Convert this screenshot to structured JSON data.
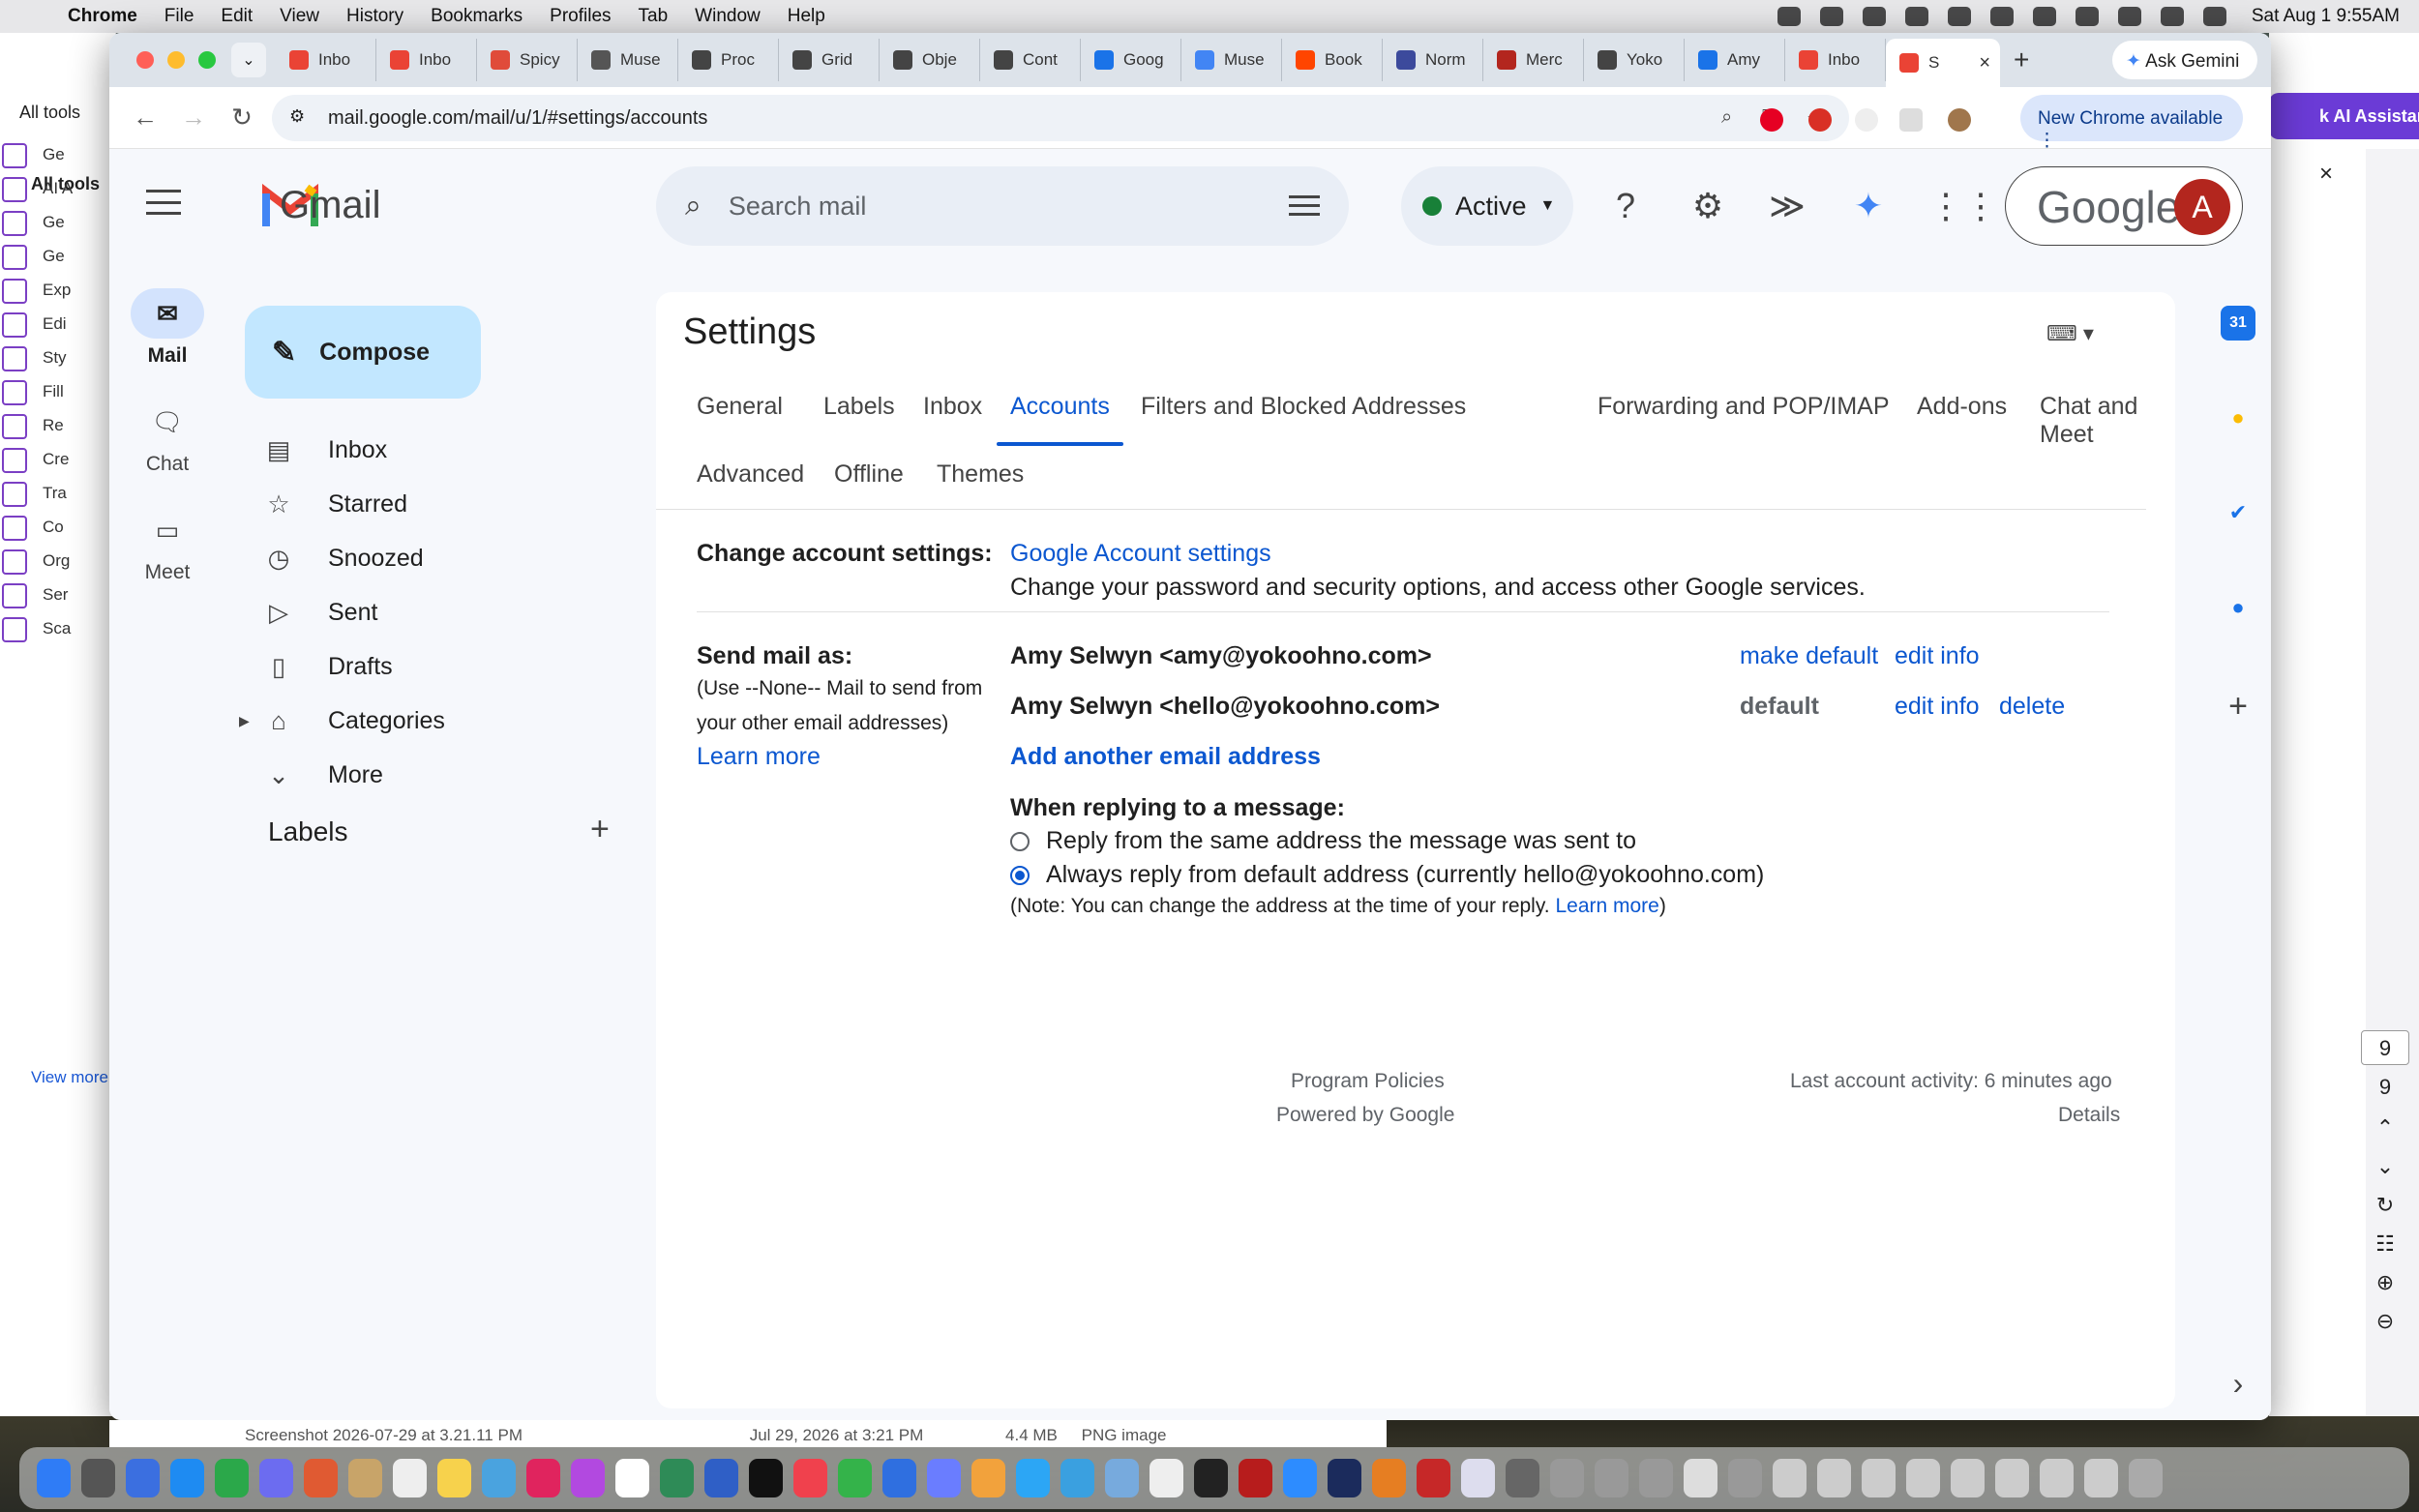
{
  "menubar": {
    "app": "Chrome",
    "items": [
      "File",
      "Edit",
      "View",
      "History",
      "Bookmarks",
      "Profiles",
      "Tab",
      "Window",
      "Help"
    ],
    "clock": "Sat Aug 1  9:55AM"
  },
  "background_app": {
    "all_tools_tab": "All tools",
    "all_tools_heading": "All tools",
    "items": [
      "Ge",
      "AI A",
      "Ge",
      "Ge",
      "Exp",
      "Edi",
      "Sty",
      "Fill",
      "Re",
      "Cre",
      "Tra",
      "Co",
      "Org",
      "Ser",
      "Sca"
    ],
    "view_more": "View more",
    "ai_assistant": "k AI Assistant",
    "close": "×"
  },
  "browser": {
    "tabs": [
      {
        "label": "Inbo",
        "color": "#ea4335"
      },
      {
        "label": "Inbo",
        "color": "#ea4335"
      },
      {
        "label": "Spicy",
        "color": "#e04b3a"
      },
      {
        "label": "Muse",
        "color": "#555555"
      },
      {
        "label": "Proc",
        "color": "#444444"
      },
      {
        "label": "Grid",
        "color": "#444444"
      },
      {
        "label": "Obje",
        "color": "#444444"
      },
      {
        "label": "Cont",
        "color": "#444444"
      },
      {
        "label": "Goog",
        "color": "#1a73e8"
      },
      {
        "label": "Muse",
        "color": "#4285f4"
      },
      {
        "label": "Book",
        "color": "#ff4500"
      },
      {
        "label": "Norm",
        "color": "#3c4a9c"
      },
      {
        "label": "Merc",
        "color": "#b3261e"
      },
      {
        "label": "Yoko",
        "color": "#444444"
      },
      {
        "label": "Amy",
        "color": "#1a73e8"
      },
      {
        "label": "Inbo",
        "color": "#ea4335"
      }
    ],
    "active_tab": "S",
    "new_tab": "+",
    "ask_gemini": "Ask Gemini",
    "url": "mail.google.com/mail/u/1/#settings/accounts",
    "new_chrome": "New Chrome available"
  },
  "gmail": {
    "product": "Gmail",
    "rail": [
      {
        "label": "Mail",
        "icon": "mail-icon"
      },
      {
        "label": "Chat",
        "icon": "chat-icon"
      },
      {
        "label": "Meet",
        "icon": "video-icon"
      }
    ],
    "compose": "Compose",
    "nav": [
      {
        "label": "Inbox",
        "icon": "inbox-icon"
      },
      {
        "label": "Starred",
        "icon": "star-icon"
      },
      {
        "label": "Snoozed",
        "icon": "clock-icon"
      },
      {
        "label": "Sent",
        "icon": "send-icon"
      },
      {
        "label": "Drafts",
        "icon": "draft-icon"
      },
      {
        "label": "Categories",
        "icon": "label-icon"
      },
      {
        "label": "More",
        "icon": "chevron-down-icon"
      }
    ],
    "labels_heading": "Labels",
    "search_placeholder": "Search mail",
    "status": "Active",
    "google_word": "Google",
    "avatar_letter": "A"
  },
  "settings": {
    "title": "Settings",
    "tabs_row1": [
      "General",
      "Labels",
      "Inbox",
      "Accounts",
      "Filters and Blocked Addresses",
      "Forwarding and POP/IMAP",
      "Add-ons",
      "Chat and Meet"
    ],
    "tabs_row2": [
      "Advanced",
      "Offline",
      "Themes"
    ],
    "active_tab": "Accounts",
    "change_account": {
      "label": "Change account settings:",
      "link": "Google Account settings",
      "desc": "Change your password and security options, and access other Google services."
    },
    "send_mail_as": {
      "label": "Send mail as:",
      "note_line1": "(Use --None-- Mail to send from",
      "note_line2": "your other email addresses)",
      "learn_more": "Learn more",
      "addresses": [
        {
          "address": "Amy Selwyn <amy@yokoohno.com>",
          "status": "make default",
          "edit": "edit info",
          "delete": ""
        },
        {
          "address": "Amy Selwyn <hello@yokoohno.com>",
          "status": "default",
          "edit": "edit info",
          "delete": "delete"
        }
      ],
      "add_another": "Add another email address",
      "reply_heading": "When replying to a message:",
      "reply_options": [
        {
          "label": "Reply from the same address the message was sent to",
          "selected": false
        },
        {
          "label": "Always reply from default address (currently hello@yokoohno.com)",
          "selected": true
        }
      ],
      "reply_note_prefix": "(Note: You can change the address at the time of your reply.",
      "reply_note_link": "Learn more",
      "reply_note_suffix": ")"
    },
    "footer": {
      "program_policies": "Program Policies",
      "powered_by": "Powered by Google",
      "last_activity": "Last account activity: 6 minutes ago",
      "details": "Details"
    }
  },
  "side_panel": {
    "calendar_day": "31",
    "add": "+",
    "collapse": "›"
  },
  "right_controls": {
    "page_box": "9",
    "page_text": "9"
  },
  "finder": {
    "filename": "Screenshot 2026-07-29 at 3.21.11 PM",
    "date": "Jul 29, 2026 at 3:21 PM",
    "size": "4.4 MB",
    "kind": "PNG image"
  }
}
